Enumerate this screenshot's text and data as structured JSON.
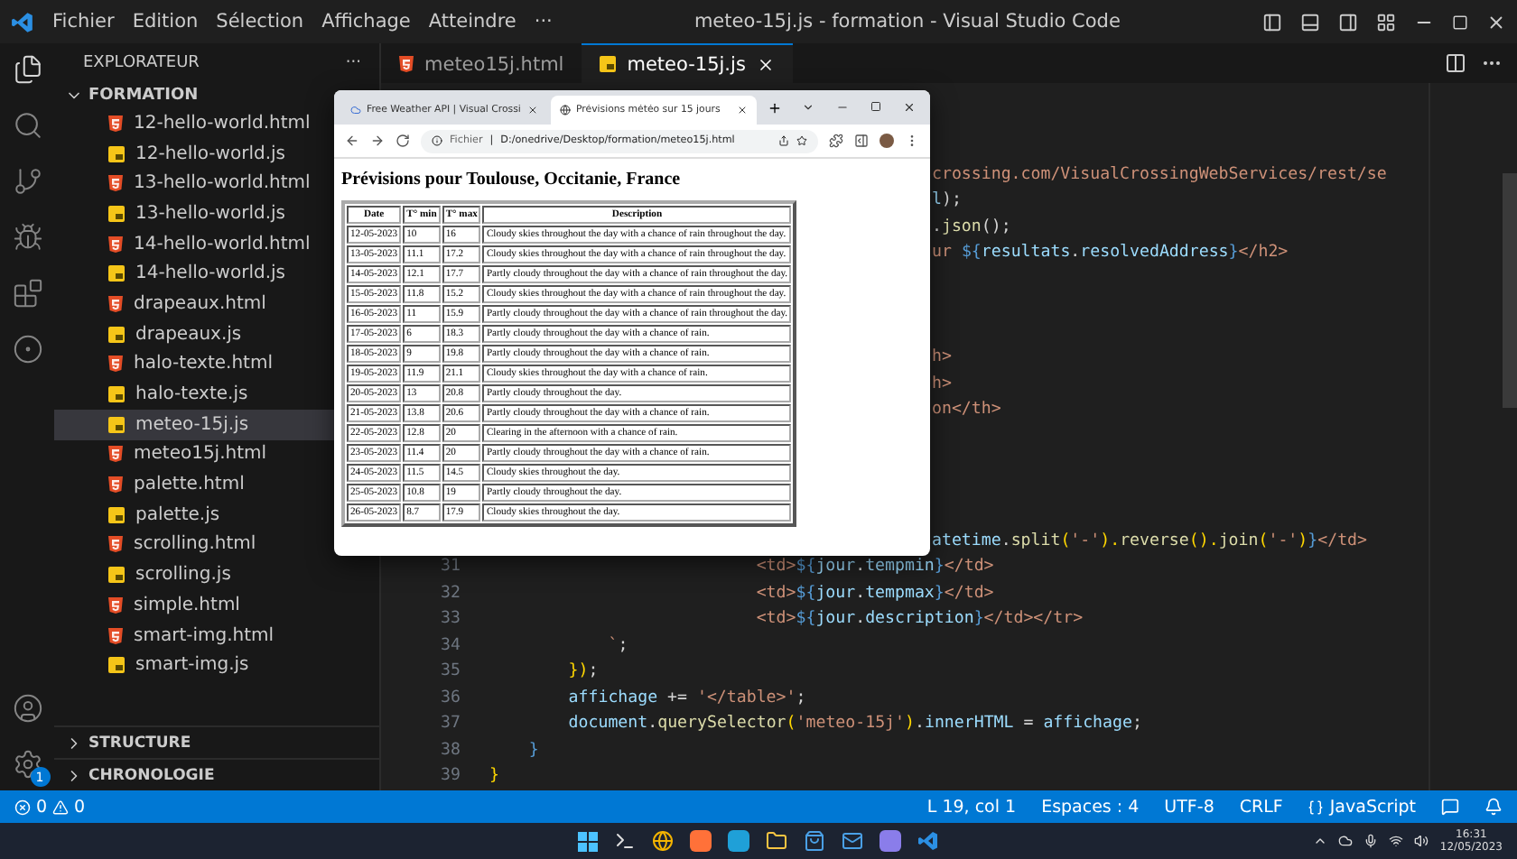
{
  "window": {
    "title": "meteo-15j.js - formation - Visual Studio Code"
  },
  "menu": [
    "Fichier",
    "Edition",
    "Sélection",
    "Affichage",
    "Atteindre",
    "···"
  ],
  "activity_bar": {
    "settings_badge": "1"
  },
  "sidebar": {
    "title": "EXPLORATEUR",
    "more": "···",
    "folder": "FORMATION",
    "files": [
      {
        "name": "12-hello-world.html",
        "kind": "html",
        "selected": false
      },
      {
        "name": "12-hello-world.js",
        "kind": "js",
        "selected": false
      },
      {
        "name": "13-hello-world.html",
        "kind": "html",
        "selected": false
      },
      {
        "name": "13-hello-world.js",
        "kind": "js",
        "selected": false
      },
      {
        "name": "14-hello-world.html",
        "kind": "html",
        "selected": false
      },
      {
        "name": "14-hello-world.js",
        "kind": "js",
        "selected": false
      },
      {
        "name": "drapeaux.html",
        "kind": "html",
        "selected": false
      },
      {
        "name": "drapeaux.js",
        "kind": "js",
        "selected": false
      },
      {
        "name": "halo-texte.html",
        "kind": "html",
        "selected": false
      },
      {
        "name": "halo-texte.js",
        "kind": "js",
        "selected": false
      },
      {
        "name": "meteo-15j.js",
        "kind": "js",
        "selected": true
      },
      {
        "name": "meteo15j.html",
        "kind": "html",
        "selected": false
      },
      {
        "name": "palette.html",
        "kind": "html",
        "selected": false
      },
      {
        "name": "palette.js",
        "kind": "js",
        "selected": false
      },
      {
        "name": "scrolling.html",
        "kind": "html",
        "selected": false
      },
      {
        "name": "scrolling.js",
        "kind": "js",
        "selected": false
      },
      {
        "name": "simple.html",
        "kind": "html",
        "selected": false
      },
      {
        "name": "smart-img.html",
        "kind": "html",
        "selected": false
      },
      {
        "name": "smart-img.js",
        "kind": "js",
        "selected": false
      }
    ],
    "sections": [
      "STRUCTURE",
      "CHRONOLOGIE"
    ]
  },
  "editor_tabs": [
    {
      "label": "meteo15j.html",
      "kind": "html",
      "selected": false
    },
    {
      "label": "meteo-15j.js",
      "kind": "js",
      "selected": true
    }
  ],
  "code_lines": [
    {
      "covered": true
    },
    {
      "covered": true
    },
    {
      "covered": true
    },
    {
      "covered": true,
      "tokens": [
        {
          "text": "crossing.com/VisualCrossingWebServices/rest/se",
          "kind": "str"
        }
      ]
    },
    {
      "covered": true,
      "tokens": [
        {
          "text": "l",
          "kind": "var"
        },
        {
          "text": ");",
          "kind": "punct"
        }
      ]
    },
    {
      "covered": true,
      "tokens": [
        {
          "text": ".",
          "kind": "punct"
        },
        {
          "text": "json",
          "kind": "fn"
        },
        {
          "text": "();",
          "kind": "punct"
        }
      ]
    },
    {
      "covered": true,
      "tokens": [
        {
          "text": "ur ",
          "kind": "str"
        },
        {
          "text": "${",
          "kind": "key"
        },
        {
          "text": "resultats",
          "kind": "var"
        },
        {
          "text": ".",
          "kind": "punct"
        },
        {
          "text": "resolvedAddress",
          "kind": "var"
        },
        {
          "text": "}",
          "kind": "key"
        },
        {
          "text": "</h2>",
          "kind": "str"
        }
      ]
    },
    {
      "covered": true
    },
    {
      "covered": true
    },
    {
      "covered": true
    },
    {
      "covered": true,
      "tokens": [
        {
          "text": "h>",
          "kind": "str"
        }
      ]
    },
    {
      "covered": true,
      "tokens": [
        {
          "text": "h>",
          "kind": "str"
        }
      ]
    },
    {
      "covered": true,
      "tokens": [
        {
          "text": "on</th>",
          "kind": "str"
        }
      ]
    },
    {
      "covered": true
    },
    {
      "covered": true
    },
    {
      "covered": true
    },
    {
      "covered": true
    },
    {
      "covered": true,
      "tokens": [
        {
          "text": "atetime",
          "kind": "var"
        },
        {
          "text": ".",
          "kind": "punct"
        },
        {
          "text": "split",
          "kind": "fn"
        },
        {
          "text": "(",
          "kind": "brace"
        },
        {
          "text": "'-'",
          "kind": "str"
        },
        {
          "text": ").",
          "kind": "brace"
        },
        {
          "text": "reverse",
          "kind": "fn"
        },
        {
          "text": "().",
          "kind": "brace"
        },
        {
          "text": "join",
          "kind": "fn"
        },
        {
          "text": "(",
          "kind": "brace"
        },
        {
          "text": "'-'",
          "kind": "str"
        },
        {
          "text": ")",
          "kind": "brace"
        },
        {
          "text": "}",
          "kind": "key"
        },
        {
          "text": "</td>",
          "kind": "str"
        }
      ]
    },
    {
      "covered": false,
      "number": "31",
      "tokens": [
        {
          "text": "                           <td>",
          "kind": "str"
        },
        {
          "text": "${",
          "kind": "key"
        },
        {
          "text": "jour",
          "kind": "var"
        },
        {
          "text": ".",
          "kind": "punct"
        },
        {
          "text": "tempmin",
          "kind": "var"
        },
        {
          "text": "}",
          "kind": "key"
        },
        {
          "text": "</td>",
          "kind": "str"
        }
      ]
    },
    {
      "covered": false,
      "number": "32",
      "tokens": [
        {
          "text": "                           <td>",
          "kind": "str"
        },
        {
          "text": "${",
          "kind": "key"
        },
        {
          "text": "jour",
          "kind": "var"
        },
        {
          "text": ".",
          "kind": "punct"
        },
        {
          "text": "tempmax",
          "kind": "var"
        },
        {
          "text": "}",
          "kind": "key"
        },
        {
          "text": "</td>",
          "kind": "str"
        }
      ]
    },
    {
      "covered": false,
      "number": "33",
      "tokens": [
        {
          "text": "                           <td>",
          "kind": "str"
        },
        {
          "text": "${",
          "kind": "key"
        },
        {
          "text": "jour",
          "kind": "var"
        },
        {
          "text": ".",
          "kind": "punct"
        },
        {
          "text": "description",
          "kind": "var"
        },
        {
          "text": "}",
          "kind": "key"
        },
        {
          "text": "</td></tr>",
          "kind": "str"
        }
      ]
    },
    {
      "covered": false,
      "number": "34",
      "tokens": [
        {
          "text": "            `",
          "kind": "str"
        },
        {
          "text": ";",
          "kind": "punct"
        }
      ]
    },
    {
      "covered": false,
      "number": "35",
      "tokens": [
        {
          "text": "        })",
          "kind": "brace"
        },
        {
          "text": ";",
          "kind": "punct"
        }
      ]
    },
    {
      "covered": false,
      "number": "36",
      "tokens": [
        {
          "text": "        affichage",
          "kind": "var"
        },
        {
          "text": " += ",
          "kind": "punct"
        },
        {
          "text": "'</table>'",
          "kind": "str"
        },
        {
          "text": ";",
          "kind": "punct"
        }
      ]
    },
    {
      "covered": false,
      "number": "37",
      "tokens": [
        {
          "text": "        document",
          "kind": "var"
        },
        {
          "text": ".",
          "kind": "punct"
        },
        {
          "text": "querySelector",
          "kind": "fn"
        },
        {
          "text": "(",
          "kind": "brace"
        },
        {
          "text": "'meteo-15j'",
          "kind": "str"
        },
        {
          "text": ")",
          "kind": "brace"
        },
        {
          "text": ".",
          "kind": "punct"
        },
        {
          "text": "innerHTML",
          "kind": "var"
        },
        {
          "text": " = ",
          "kind": "punct"
        },
        {
          "text": "affichage",
          "kind": "var"
        },
        {
          "text": ";",
          "kind": "punct"
        }
      ]
    },
    {
      "covered": false,
      "number": "38",
      "tokens": [
        {
          "text": "    }",
          "kind": "key"
        }
      ]
    },
    {
      "covered": false,
      "number": "39",
      "tokens": [
        {
          "text": "}",
          "kind": "brace"
        }
      ]
    }
  ],
  "browser": {
    "tabs": [
      {
        "label": "Free Weather API | Visual Crossi",
        "selected": false
      },
      {
        "label": "Prévisions météo sur 15 jours",
        "selected": true
      }
    ],
    "address_scheme": "Fichier",
    "address_separator": "|",
    "address": "D:/onedrive/Desktop/formation/meteo15j.html",
    "heading": "Prévisions pour Toulouse, Occitanie, France",
    "table": {
      "columns": [
        "Date",
        "T° min",
        "T° max",
        "Description"
      ],
      "rows": [
        [
          "12-05-2023",
          "10",
          "16",
          "Cloudy skies throughout the day with a chance of rain throughout the day."
        ],
        [
          "13-05-2023",
          "11.1",
          "17.2",
          "Cloudy skies throughout the day with a chance of rain throughout the day."
        ],
        [
          "14-05-2023",
          "12.1",
          "17.7",
          "Partly cloudy throughout the day with a chance of rain throughout the day."
        ],
        [
          "15-05-2023",
          "11.8",
          "15.2",
          "Cloudy skies throughout the day with a chance of rain throughout the day."
        ],
        [
          "16-05-2023",
          "11",
          "15.9",
          "Partly cloudy throughout the day with a chance of rain throughout the day."
        ],
        [
          "17-05-2023",
          "6",
          "18.3",
          "Partly cloudy throughout the day with a chance of rain."
        ],
        [
          "18-05-2023",
          "9",
          "19.8",
          "Partly cloudy throughout the day with a chance of rain."
        ],
        [
          "19-05-2023",
          "11.9",
          "21.1",
          "Cloudy skies throughout the day with a chance of rain."
        ],
        [
          "20-05-2023",
          "13",
          "20.8",
          "Partly cloudy throughout the day."
        ],
        [
          "21-05-2023",
          "13.8",
          "20.6",
          "Partly cloudy throughout the day with a chance of rain."
        ],
        [
          "22-05-2023",
          "12.8",
          "20",
          "Clearing in the afternoon with a chance of rain."
        ],
        [
          "23-05-2023",
          "11.4",
          "20",
          "Partly cloudy throughout the day with a chance of rain."
        ],
        [
          "24-05-2023",
          "11.5",
          "14.5",
          "Cloudy skies throughout the day."
        ],
        [
          "25-05-2023",
          "10.8",
          "19",
          "Partly cloudy throughout the day."
        ],
        [
          "26-05-2023",
          "8.7",
          "17.9",
          "Cloudy skies throughout the day."
        ]
      ]
    }
  },
  "status_bar": {
    "errors": "0",
    "warnings": "0",
    "items": [
      "L 19, col 1",
      "Espaces : 4",
      "UTF-8",
      "CRLF",
      "JavaScript"
    ]
  },
  "taskbar": {
    "time": "16:31",
    "date": "12/05/2023"
  }
}
